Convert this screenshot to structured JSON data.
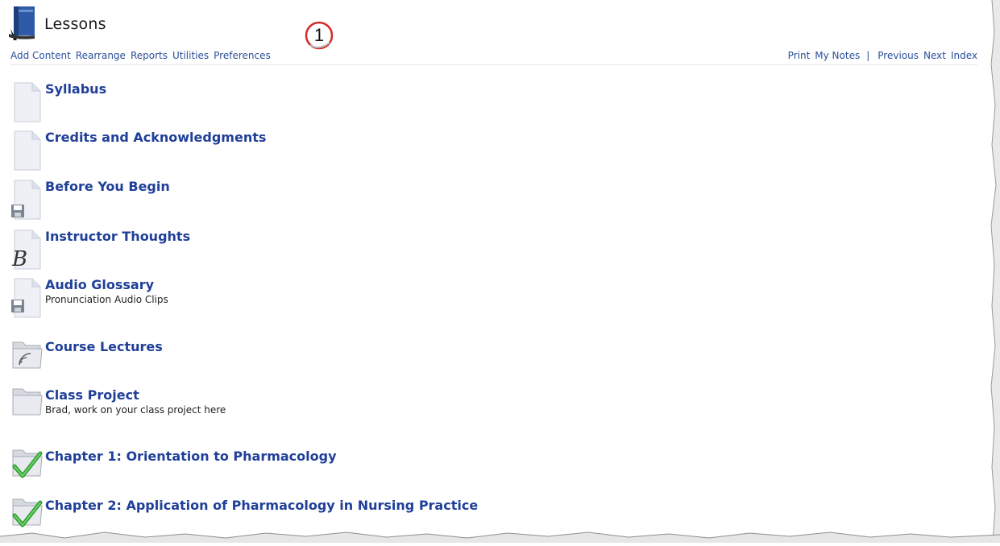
{
  "header": {
    "title": "Lessons",
    "callout_number": "1"
  },
  "toolbar": {
    "left": [
      "Add Content",
      "Rearrange",
      "Reports",
      "Utilities",
      "Preferences"
    ],
    "right": [
      "Print",
      "My Notes",
      "Previous",
      "Next",
      "Index"
    ],
    "separator": "|"
  },
  "lessons": [
    {
      "title": "Syllabus",
      "subtitle": "",
      "icon": "document-icon"
    },
    {
      "title": "Credits and Acknowledgments",
      "subtitle": "",
      "icon": "document-icon"
    },
    {
      "title": "Before You Begin",
      "subtitle": "",
      "icon": "floppy-document-icon"
    },
    {
      "title": "Instructor Thoughts",
      "subtitle": "",
      "icon": "script-b-document-icon"
    },
    {
      "title": "Audio Glossary",
      "subtitle": "Pronunciation Audio Clips",
      "icon": "floppy-document-icon"
    },
    {
      "title": "Course Lectures",
      "subtitle": "",
      "icon": "rss-folder-icon"
    },
    {
      "title": "Class Project",
      "subtitle": "Brad, work on your class project here",
      "icon": "folder-icon"
    },
    {
      "title": "Chapter 1: Orientation to Pharmacology",
      "subtitle": "",
      "icon": "checked-folder-icon"
    },
    {
      "title": "Chapter 2: Application of Pharmacology in Nursing Practice",
      "subtitle": "",
      "icon": "checked-folder-icon"
    }
  ],
  "colors": {
    "link": "#1f3f99",
    "toolbar_link": "#2a4f99",
    "callout_ring": "#d42a2a"
  }
}
